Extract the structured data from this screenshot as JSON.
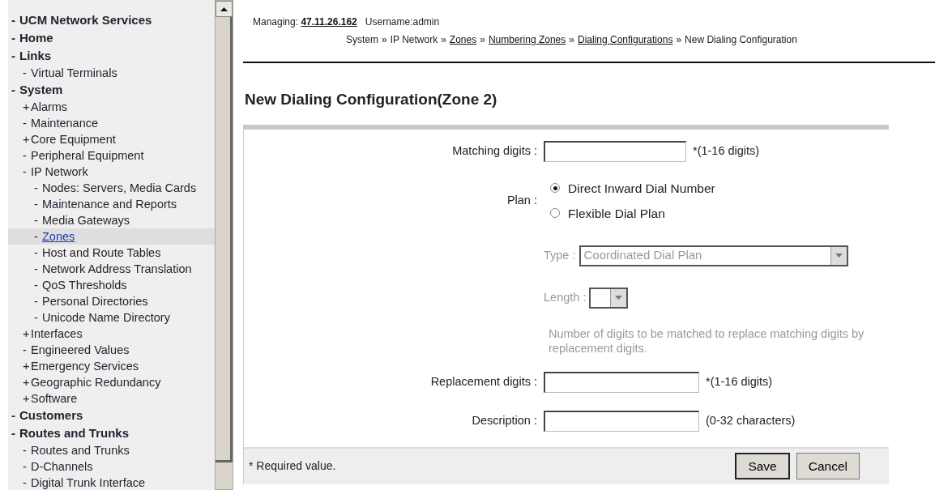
{
  "sidebar": {
    "items": [
      {
        "sign": "-",
        "label": "UCM Network Services",
        "selected": false
      },
      {
        "sign": "-",
        "label": "Home",
        "selected": false
      },
      {
        "sign": "-",
        "label": "Links",
        "selected": false,
        "children": [
          {
            "sign": "-",
            "label": "Virtual Terminals",
            "selected": false
          }
        ]
      },
      {
        "sign": "-",
        "label": "System",
        "selected": false,
        "children": [
          {
            "sign": "+",
            "label": "Alarms",
            "selected": false
          },
          {
            "sign": "-",
            "label": "Maintenance",
            "selected": false
          },
          {
            "sign": "+",
            "label": "Core Equipment",
            "selected": false
          },
          {
            "sign": "-",
            "label": "Peripheral Equipment",
            "selected": false
          },
          {
            "sign": "-",
            "label": "IP Network",
            "selected": false,
            "children": [
              {
                "sign": "-",
                "label": "Nodes: Servers, Media Cards",
                "selected": false
              },
              {
                "sign": "-",
                "label": "Maintenance and Reports",
                "selected": false
              },
              {
                "sign": "-",
                "label": "Media Gateways",
                "selected": false
              },
              {
                "sign": "-",
                "label": "Zones",
                "selected": true
              },
              {
                "sign": "-",
                "label": "Host and Route Tables",
                "selected": false
              },
              {
                "sign": "-",
                "label": "Network Address Translation",
                "selected": false
              },
              {
                "sign": "-",
                "label": "QoS Thresholds",
                "selected": false
              },
              {
                "sign": "-",
                "label": "Personal Directories",
                "selected": false
              },
              {
                "sign": "-",
                "label": "Unicode Name Directory",
                "selected": false
              }
            ]
          },
          {
            "sign": "+",
            "label": "Interfaces",
            "selected": false
          },
          {
            "sign": "-",
            "label": "Engineered Values",
            "selected": false
          },
          {
            "sign": "+",
            "label": "Emergency Services",
            "selected": false
          },
          {
            "sign": "+",
            "label": "Geographic Redundancy",
            "selected": false
          },
          {
            "sign": "+",
            "label": "Software",
            "selected": false
          }
        ]
      },
      {
        "sign": "-",
        "label": "Customers",
        "selected": false
      },
      {
        "sign": "-",
        "label": "Routes and Trunks",
        "selected": false,
        "children": [
          {
            "sign": "-",
            "label": "Routes and Trunks",
            "selected": false
          },
          {
            "sign": "-",
            "label": "D-Channels",
            "selected": false
          },
          {
            "sign": "-",
            "label": "Digital Trunk Interface",
            "selected": false
          }
        ]
      }
    ]
  },
  "header": {
    "managing_label": "Managing:",
    "address": "47.11.26.162",
    "username": "Username:admin",
    "breadcrumb": [
      {
        "label": "System",
        "link": false
      },
      {
        "label": "IP Network",
        "link": false
      },
      {
        "label": "Zones",
        "link": true
      },
      {
        "label": "Numbering Zones",
        "link": true
      },
      {
        "label": "Dialing Configurations",
        "link": true
      },
      {
        "label": "New Dialing Configuration",
        "link": false
      }
    ],
    "separator": "»"
  },
  "title": "New Dialing Configuration(Zone 2)",
  "form": {
    "rows": [
      {
        "kind": "text",
        "label": "Matching digits :",
        "hint": "*(1-16 digits)"
      },
      {
        "kind": "radio",
        "label": "Plan :",
        "options": [
          {
            "label": "Direct Inward Dial Number",
            "selected": true
          },
          {
            "label": "Flexible Dial Plan",
            "selected": false
          }
        ]
      },
      {
        "kind": "select",
        "label": "Type :",
        "value": "Coordinated Dial Plan",
        "disabled": true
      },
      {
        "kind": "select",
        "label": "Length :",
        "disabled": true
      },
      {
        "kind": "note",
        "text": "Number of digits to be matched to replace matching digits by replacement digits."
      },
      {
        "kind": "text",
        "label": "Replacement digits :",
        "hint": "*(1-16 digits)"
      },
      {
        "kind": "text",
        "label": "Description :",
        "hint": "(0-32 characters)"
      }
    ],
    "footer_note": "* Required value.",
    "buttons": [
      "Save",
      "Cancel"
    ]
  }
}
